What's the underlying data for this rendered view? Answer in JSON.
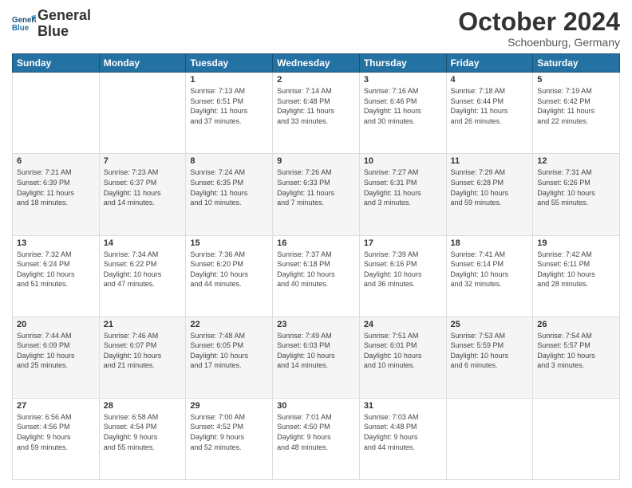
{
  "header": {
    "logo_line1": "General",
    "logo_line2": "Blue",
    "month": "October 2024",
    "location": "Schoenburg, Germany"
  },
  "weekdays": [
    "Sunday",
    "Monday",
    "Tuesday",
    "Wednesday",
    "Thursday",
    "Friday",
    "Saturday"
  ],
  "weeks": [
    [
      {
        "day": "",
        "info": ""
      },
      {
        "day": "",
        "info": ""
      },
      {
        "day": "1",
        "info": "Sunrise: 7:13 AM\nSunset: 6:51 PM\nDaylight: 11 hours\nand 37 minutes."
      },
      {
        "day": "2",
        "info": "Sunrise: 7:14 AM\nSunset: 6:48 PM\nDaylight: 11 hours\nand 33 minutes."
      },
      {
        "day": "3",
        "info": "Sunrise: 7:16 AM\nSunset: 6:46 PM\nDaylight: 11 hours\nand 30 minutes."
      },
      {
        "day": "4",
        "info": "Sunrise: 7:18 AM\nSunset: 6:44 PM\nDaylight: 11 hours\nand 26 minutes."
      },
      {
        "day": "5",
        "info": "Sunrise: 7:19 AM\nSunset: 6:42 PM\nDaylight: 11 hours\nand 22 minutes."
      }
    ],
    [
      {
        "day": "6",
        "info": "Sunrise: 7:21 AM\nSunset: 6:39 PM\nDaylight: 11 hours\nand 18 minutes."
      },
      {
        "day": "7",
        "info": "Sunrise: 7:23 AM\nSunset: 6:37 PM\nDaylight: 11 hours\nand 14 minutes."
      },
      {
        "day": "8",
        "info": "Sunrise: 7:24 AM\nSunset: 6:35 PM\nDaylight: 11 hours\nand 10 minutes."
      },
      {
        "day": "9",
        "info": "Sunrise: 7:26 AM\nSunset: 6:33 PM\nDaylight: 11 hours\nand 7 minutes."
      },
      {
        "day": "10",
        "info": "Sunrise: 7:27 AM\nSunset: 6:31 PM\nDaylight: 11 hours\nand 3 minutes."
      },
      {
        "day": "11",
        "info": "Sunrise: 7:29 AM\nSunset: 6:28 PM\nDaylight: 10 hours\nand 59 minutes."
      },
      {
        "day": "12",
        "info": "Sunrise: 7:31 AM\nSunset: 6:26 PM\nDaylight: 10 hours\nand 55 minutes."
      }
    ],
    [
      {
        "day": "13",
        "info": "Sunrise: 7:32 AM\nSunset: 6:24 PM\nDaylight: 10 hours\nand 51 minutes."
      },
      {
        "day": "14",
        "info": "Sunrise: 7:34 AM\nSunset: 6:22 PM\nDaylight: 10 hours\nand 47 minutes."
      },
      {
        "day": "15",
        "info": "Sunrise: 7:36 AM\nSunset: 6:20 PM\nDaylight: 10 hours\nand 44 minutes."
      },
      {
        "day": "16",
        "info": "Sunrise: 7:37 AM\nSunset: 6:18 PM\nDaylight: 10 hours\nand 40 minutes."
      },
      {
        "day": "17",
        "info": "Sunrise: 7:39 AM\nSunset: 6:16 PM\nDaylight: 10 hours\nand 36 minutes."
      },
      {
        "day": "18",
        "info": "Sunrise: 7:41 AM\nSunset: 6:14 PM\nDaylight: 10 hours\nand 32 minutes."
      },
      {
        "day": "19",
        "info": "Sunrise: 7:42 AM\nSunset: 6:11 PM\nDaylight: 10 hours\nand 28 minutes."
      }
    ],
    [
      {
        "day": "20",
        "info": "Sunrise: 7:44 AM\nSunset: 6:09 PM\nDaylight: 10 hours\nand 25 minutes."
      },
      {
        "day": "21",
        "info": "Sunrise: 7:46 AM\nSunset: 6:07 PM\nDaylight: 10 hours\nand 21 minutes."
      },
      {
        "day": "22",
        "info": "Sunrise: 7:48 AM\nSunset: 6:05 PM\nDaylight: 10 hours\nand 17 minutes."
      },
      {
        "day": "23",
        "info": "Sunrise: 7:49 AM\nSunset: 6:03 PM\nDaylight: 10 hours\nand 14 minutes."
      },
      {
        "day": "24",
        "info": "Sunrise: 7:51 AM\nSunset: 6:01 PM\nDaylight: 10 hours\nand 10 minutes."
      },
      {
        "day": "25",
        "info": "Sunrise: 7:53 AM\nSunset: 5:59 PM\nDaylight: 10 hours\nand 6 minutes."
      },
      {
        "day": "26",
        "info": "Sunrise: 7:54 AM\nSunset: 5:57 PM\nDaylight: 10 hours\nand 3 minutes."
      }
    ],
    [
      {
        "day": "27",
        "info": "Sunrise: 6:56 AM\nSunset: 4:56 PM\nDaylight: 9 hours\nand 59 minutes."
      },
      {
        "day": "28",
        "info": "Sunrise: 6:58 AM\nSunset: 4:54 PM\nDaylight: 9 hours\nand 55 minutes."
      },
      {
        "day": "29",
        "info": "Sunrise: 7:00 AM\nSunset: 4:52 PM\nDaylight: 9 hours\nand 52 minutes."
      },
      {
        "day": "30",
        "info": "Sunrise: 7:01 AM\nSunset: 4:50 PM\nDaylight: 9 hours\nand 48 minutes."
      },
      {
        "day": "31",
        "info": "Sunrise: 7:03 AM\nSunset: 4:48 PM\nDaylight: 9 hours\nand 44 minutes."
      },
      {
        "day": "",
        "info": ""
      },
      {
        "day": "",
        "info": ""
      }
    ]
  ]
}
